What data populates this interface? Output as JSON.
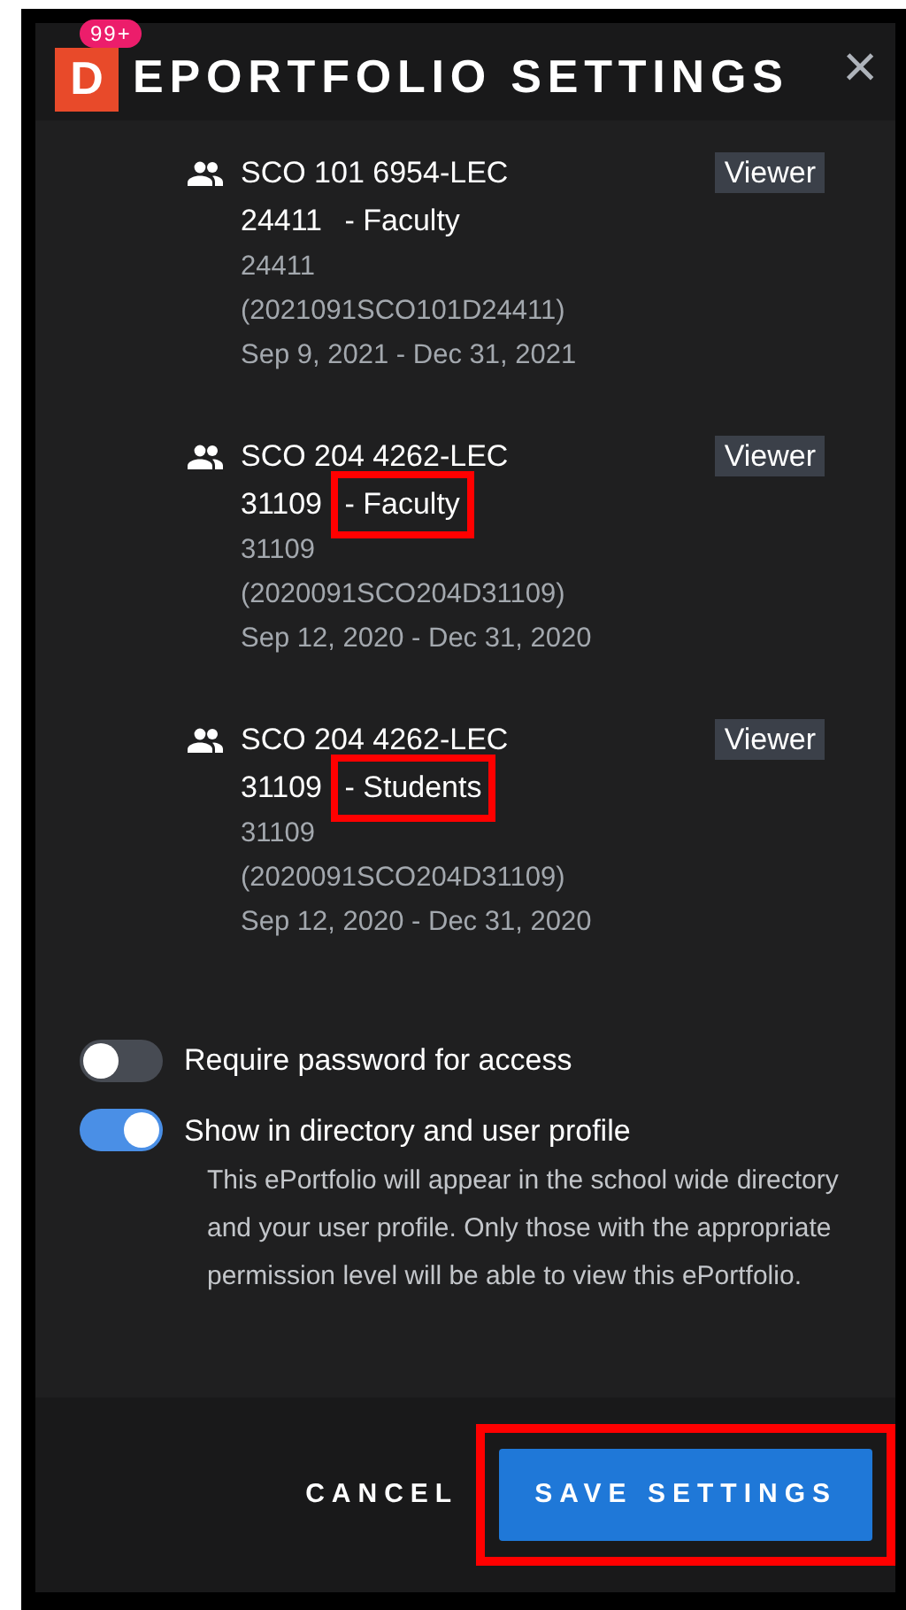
{
  "header": {
    "logo_letter": "D",
    "notification_count": "99+",
    "title": "EPORTFOLIO SETTINGS",
    "close": "×"
  },
  "groups": [
    {
      "course": "SCO 101 6954-LEC",
      "section": "24411",
      "role": "- Faculty",
      "highlighted": false,
      "access": "Viewer",
      "code": "24411",
      "full_code": "(2021091SCO101D24411)",
      "dates": "Sep 9, 2021 - Dec 31, 2021"
    },
    {
      "course": "SCO 204 4262-LEC",
      "section": "31109",
      "role": "- Faculty",
      "highlighted": true,
      "access": "Viewer",
      "code": "31109",
      "full_code": "(2020091SCO204D31109)",
      "dates": "Sep 12, 2020 - Dec 31, 2020"
    },
    {
      "course": "SCO 204 4262-LEC",
      "section": "31109",
      "role": "- Students",
      "highlighted": true,
      "access": "Viewer",
      "code": "31109",
      "full_code": "(2020091SCO204D31109)",
      "dates": "Sep 12, 2020 - Dec 31, 2020"
    }
  ],
  "settings": [
    {
      "label": "Require password for access",
      "on": false
    },
    {
      "label": "Show in directory and user profile",
      "on": true,
      "description": "This ePortfolio will appear in the school wide directory and your user profile. Only those with the appropriate permission level will be able to view this ePortfolio."
    }
  ],
  "footer": {
    "cancel": "CANCEL",
    "save": "SAVE SETTINGS",
    "save_highlighted": true
  }
}
